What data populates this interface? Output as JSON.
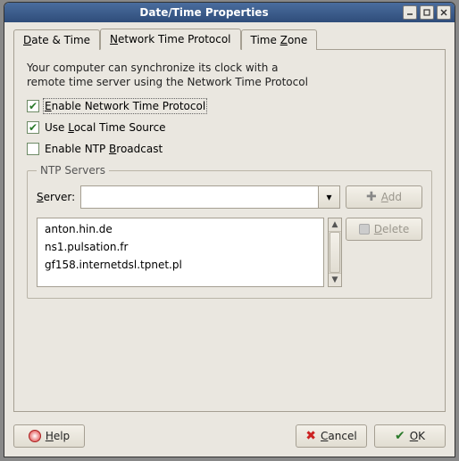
{
  "window": {
    "title": "Date/Time Properties",
    "min_tip": "Minimize",
    "max_tip": "Maximize",
    "close_tip": "Close"
  },
  "tabs": [
    {
      "label_pre": "",
      "ul": "D",
      "label_post": "ate & Time"
    },
    {
      "label_pre": "",
      "ul": "N",
      "label_post": "etwork Time Protocol"
    },
    {
      "label_pre": "Time ",
      "ul": "Z",
      "label_post": "one"
    }
  ],
  "info_line1": "Your computer can synchronize its clock with a",
  "info_line2": "remote time server using the Network Time Protocol",
  "checks": {
    "enable": {
      "checked": true,
      "pre": "",
      "ul": "E",
      "post": "nable Network Time Protocol"
    },
    "local": {
      "checked": true,
      "pre": "Use ",
      "ul": "L",
      "post": "ocal Time Source"
    },
    "broadcast": {
      "checked": false,
      "pre": "Enable NTP ",
      "ul": "B",
      "post": "roadcast"
    }
  },
  "ntp": {
    "legend": "NTP Servers",
    "server_label_ul": "S",
    "server_label_post": "erver:",
    "server_value": "",
    "add_label_ul": "A",
    "add_label_post": "dd",
    "delete_label_ul": "D",
    "delete_label_post": "elete",
    "list": [
      "anton.hin.de",
      "ns1.pulsation.fr",
      "gf158.internetdsl.tpnet.pl"
    ]
  },
  "footer": {
    "help_ul": "H",
    "help_post": "elp",
    "cancel_ul": "C",
    "cancel_post": "ancel",
    "ok_ul": "O",
    "ok_post": "K"
  }
}
